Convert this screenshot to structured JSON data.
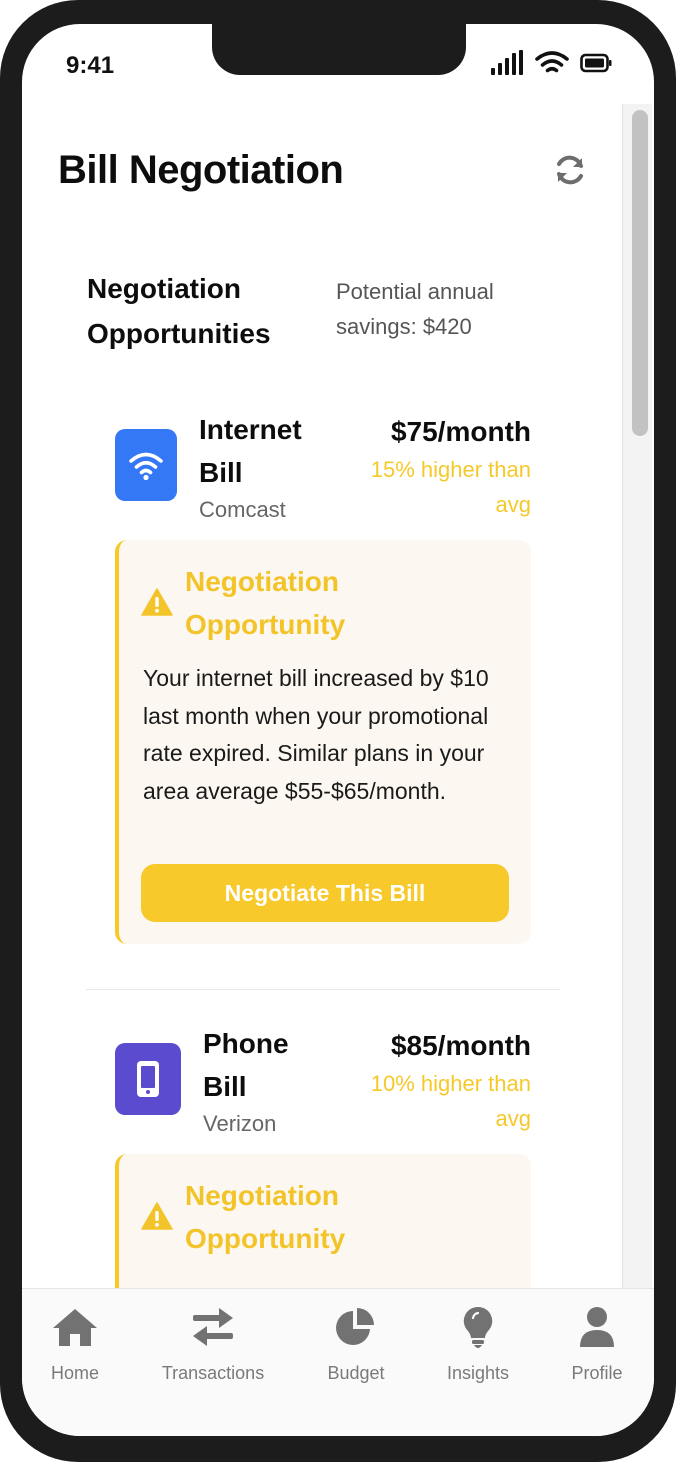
{
  "status_bar": {
    "time": "9:41"
  },
  "header": {
    "title": "Bill Negotiation",
    "refresh_icon": "refresh-icon"
  },
  "summary": {
    "section_title": "Negotiation Opportunities",
    "savings_text": "Potential annual savings: $420"
  },
  "bills": [
    {
      "name": "Internet Bill",
      "provider": "Comcast",
      "amount": "$75/month",
      "comparison": "15% higher than avg",
      "icon": "wifi-icon",
      "icon_color": "#3478f6",
      "opportunity": {
        "title": "Negotiation Opportunity",
        "body": "Your internet bill increased by $10 last month when your promotional rate expired. Similar plans in your area average $55-$65/month.",
        "button": "Negotiate This Bill"
      }
    },
    {
      "name": "Phone Bill",
      "provider": "Verizon",
      "amount": "$85/month",
      "comparison": "10% higher than avg",
      "icon": "phone-icon",
      "icon_color": "#5b4ccf",
      "opportunity": {
        "title": "Negotiation Opportunity"
      }
    }
  ],
  "tabbar": {
    "tabs": [
      {
        "label": "Home",
        "icon": "home-icon"
      },
      {
        "label": "Transactions",
        "icon": "exchange-icon"
      },
      {
        "label": "Budget",
        "icon": "pie-chart-icon"
      },
      {
        "label": "Insights",
        "icon": "lightbulb-icon"
      },
      {
        "label": "Profile",
        "icon": "user-icon"
      }
    ]
  },
  "colors": {
    "accent": "#f7c92a",
    "warning_text": "#f3c42a",
    "card_bg": "#fcf8f1"
  }
}
